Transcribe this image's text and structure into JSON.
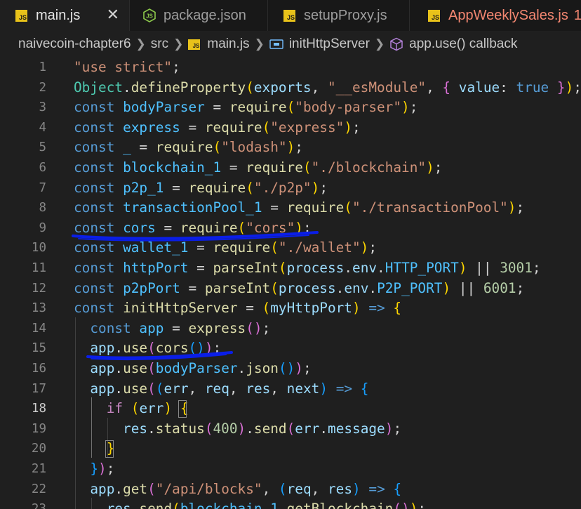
{
  "tabs": [
    {
      "label": "main.js",
      "icon": "js-file-icon",
      "active": true,
      "close": "✕"
    },
    {
      "label": "package.json",
      "icon": "nodejs-icon"
    },
    {
      "label": "setupProxy.js",
      "icon": "js-file-icon"
    },
    {
      "label": "AppWeeklySales.js",
      "icon": "js-file-icon",
      "badge": "1",
      "status": "error"
    }
  ],
  "breadcrumb": {
    "folder": "naivecoin-chapter6",
    "subfolder": "src",
    "file": "main.js",
    "function": "initHttpServer",
    "callback": "app.use() callback",
    "file_icon_text": "JS"
  },
  "editor": {
    "current_line": 18,
    "lines": [
      {
        "n": "1"
      },
      {
        "n": "2"
      },
      {
        "n": "3"
      },
      {
        "n": "4"
      },
      {
        "n": "5"
      },
      {
        "n": "6"
      },
      {
        "n": "7"
      },
      {
        "n": "8"
      },
      {
        "n": "9"
      },
      {
        "n": "10"
      },
      {
        "n": "11"
      },
      {
        "n": "12"
      },
      {
        "n": "13"
      },
      {
        "n": "14"
      },
      {
        "n": "15"
      },
      {
        "n": "16"
      },
      {
        "n": "17"
      },
      {
        "n": "18"
      },
      {
        "n": "19"
      },
      {
        "n": "20"
      },
      {
        "n": "21"
      },
      {
        "n": "22"
      },
      {
        "n": "23"
      }
    ]
  },
  "colors": {
    "keyword": "#569cd6",
    "string": "#ce9178",
    "function": "#dcdcaa",
    "variable": "#9cdcfe",
    "annotation": "#0a1ee8"
  }
}
